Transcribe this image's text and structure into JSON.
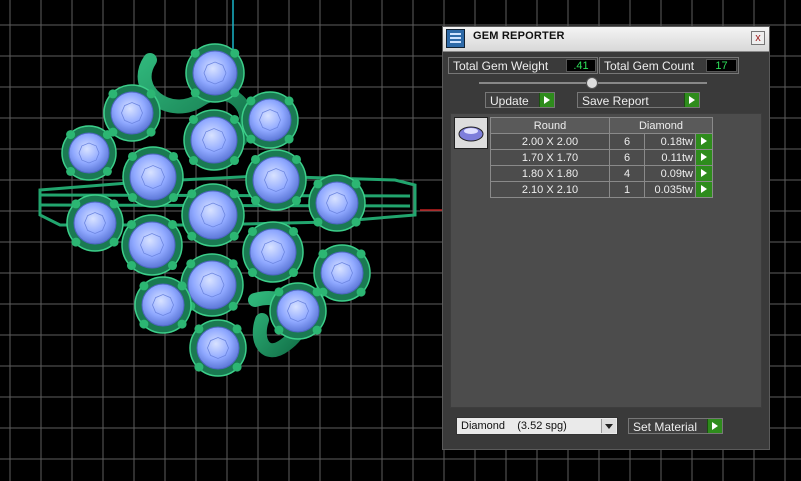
{
  "panel": {
    "title": "GEM REPORTER",
    "close_glyph": "x",
    "total_weight_label": "Total Gem Weight",
    "total_weight_value": ".41",
    "total_count_label": "Total Gem Count",
    "total_count_value": "17",
    "update_label": "Update",
    "save_report_label": "Save Report",
    "table": {
      "shape_header": "Round",
      "material_header": "Diamond",
      "rows": [
        {
          "size": "2.00 X 2.00",
          "count": "6",
          "weight": "0.18tw"
        },
        {
          "size": "1.70 X 1.70",
          "count": "6",
          "weight": "0.11tw"
        },
        {
          "size": "1.80 X 1.80",
          "count": "4",
          "weight": "0.09tw"
        },
        {
          "size": "2.10 X 2.10",
          "count": "1",
          "weight": "0.035tw"
        }
      ]
    },
    "material_select_value": "Diamond    (3.52 spg)",
    "set_material_label": "Set Material"
  },
  "colors": {
    "metal": "#1f8a5e",
    "gem": "#9fb6ff",
    "grid": "#5e5e5e",
    "value_text": "#2ee05a",
    "button_green": "#2e8c1c"
  },
  "icons": [
    "gem-reporter-icon",
    "close-icon",
    "slider-knob",
    "play-arrow-icon",
    "dropdown-arrow-icon",
    "gem-thumbnail"
  ]
}
